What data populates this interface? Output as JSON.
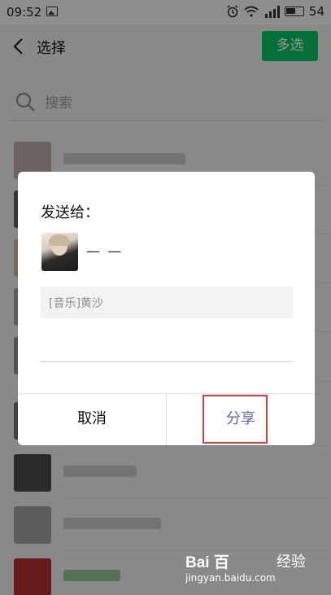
{
  "status_bar": {
    "time": "09:52",
    "battery": "54"
  },
  "header": {
    "title": "选择",
    "multi_select_label": "多选"
  },
  "search": {
    "placeholder": "搜索"
  },
  "dialog": {
    "title": "发送给：",
    "target_name": "— —",
    "shared_item": "[音乐]黄沙",
    "cancel_label": "取消",
    "share_label": "分享"
  },
  "watermark": {
    "logo": "Bai 百",
    "brand": "经验",
    "url": "jingyan.baidu.com"
  },
  "colors": {
    "accent_green": "#07c160",
    "share_text": "#576b95",
    "highlight_border": "#e03b3b"
  }
}
